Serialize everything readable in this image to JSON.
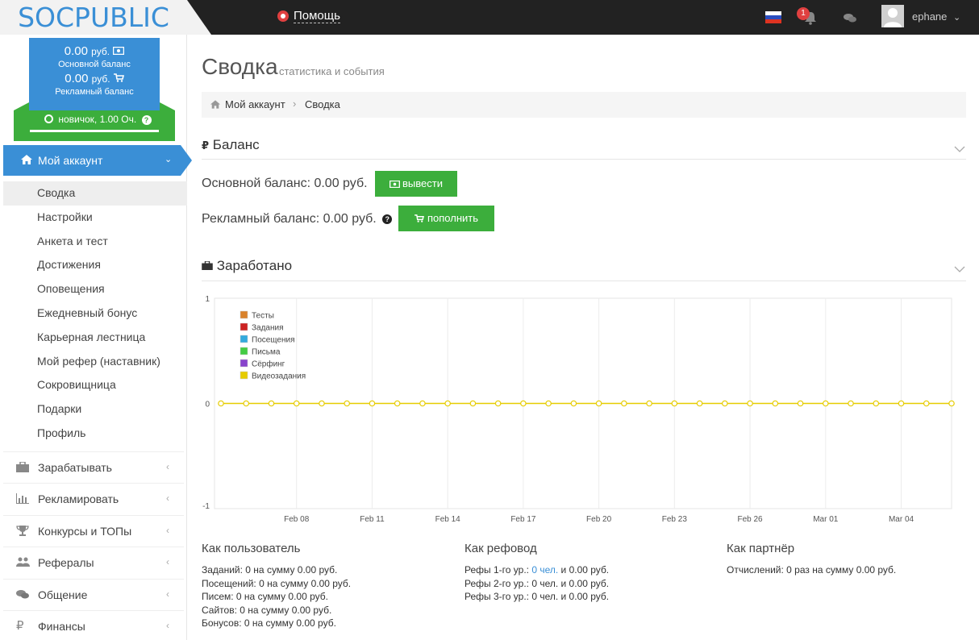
{
  "brand": {
    "logo": "SOCPUBLIC"
  },
  "topbar": {
    "help_label": "Помощь",
    "notification_count": "1",
    "username": "ephane",
    "user_chevron": "⌄"
  },
  "sidebar": {
    "main_balance": {
      "amount": "0.00",
      "currency": "руб.",
      "label": "Основной баланс"
    },
    "ad_balance": {
      "amount": "0.00",
      "currency": "руб.",
      "label": "Рекламный баланс"
    },
    "level": "новичок, 1.00 Оч.",
    "active_section": {
      "label": "Мой аккаунт",
      "chevron": "⌄"
    },
    "sub_items": [
      {
        "label": "Сводка"
      },
      {
        "label": "Настройки"
      },
      {
        "label": "Анкета и тест"
      },
      {
        "label": "Достижения"
      },
      {
        "label": "Оповещения"
      },
      {
        "label": "Ежедневный бонус"
      },
      {
        "label": "Карьерная лестница"
      },
      {
        "label": "Мой рефер (наставник)"
      },
      {
        "label": "Сокровищница"
      },
      {
        "label": "Подарки"
      },
      {
        "label": "Профиль"
      }
    ],
    "nav_items": [
      {
        "label": "Зарабатывать",
        "icon": "briefcase-icon",
        "glyph": "▬"
      },
      {
        "label": "Рекламировать",
        "icon": "bar-chart-icon",
        "glyph": "ılıl"
      },
      {
        "label": "Конкурсы и ТОПы",
        "icon": "trophy-icon",
        "glyph": "♆"
      },
      {
        "label": "Рефералы",
        "icon": "users-icon",
        "glyph": "👥"
      },
      {
        "label": "Общение",
        "icon": "chat-icon",
        "glyph": "💬"
      },
      {
        "label": "Финансы",
        "icon": "ruble-icon",
        "glyph": "₽"
      }
    ],
    "collapsed_chevron": "‹"
  },
  "page": {
    "title": "Сводка",
    "subtitle": "статистика и события",
    "breadcrumb": [
      "Мой аккаунт",
      "Сводка"
    ],
    "breadcrumb_sep": "›"
  },
  "balance_section": {
    "icon_glyph": "₽",
    "title": "Баланс",
    "main_line": "Основной баланс: 0.00 руб.",
    "withdraw_button": "вывести",
    "ad_line": "Рекламный баланс: 0.00 руб.",
    "topup_button": "пополнить"
  },
  "earned_section": {
    "title": "Заработано"
  },
  "chart_data": {
    "type": "line",
    "ylim": [
      -1,
      1
    ],
    "yticks": [
      "1",
      "0",
      "-1"
    ],
    "x_tick_labels": [
      "Feb 08",
      "Feb 11",
      "Feb 14",
      "Feb 17",
      "Feb 20",
      "Feb 23",
      "Feb 26",
      "Mar 01",
      "Mar 04"
    ],
    "series": [
      {
        "name": "Тесты",
        "color": "#d9822b"
      },
      {
        "name": "Задания",
        "color": "#cc2222"
      },
      {
        "name": "Посещения",
        "color": "#33aadd"
      },
      {
        "name": "Письма",
        "color": "#44cc44"
      },
      {
        "name": "Сёрфинг",
        "color": "#8844cc"
      },
      {
        "name": "Видеозадания",
        "color": "#e6cc00"
      }
    ],
    "x_dates": [
      "Feb 05",
      "Feb 06",
      "Feb 07",
      "Feb 08",
      "Feb 09",
      "Feb 10",
      "Feb 11",
      "Feb 12",
      "Feb 13",
      "Feb 14",
      "Feb 15",
      "Feb 16",
      "Feb 17",
      "Feb 18",
      "Feb 19",
      "Feb 20",
      "Feb 21",
      "Feb 22",
      "Feb 23",
      "Feb 24",
      "Feb 25",
      "Feb 26",
      "Feb 27",
      "Feb 28",
      "Mar 01",
      "Mar 02",
      "Mar 03",
      "Mar 04",
      "Mar 05",
      "Mar 06"
    ],
    "values": [
      0,
      0,
      0,
      0,
      0,
      0,
      0,
      0,
      0,
      0,
      0,
      0,
      0,
      0,
      0,
      0,
      0,
      0,
      0,
      0,
      0,
      0,
      0,
      0,
      0,
      0,
      0,
      0,
      0,
      0
    ],
    "legend": "top-left",
    "grid": true
  },
  "stats": {
    "user": {
      "title": "Как пользователь",
      "lines": [
        "Заданий: 0 на сумму 0.00 руб.",
        "Посещений: 0 на сумму 0.00 руб.",
        "Писем: 0 на сумму 0.00 руб.",
        "Сайтов: 0 на сумму 0.00 руб.",
        "Бонусов: 0 на сумму 0.00 руб."
      ]
    },
    "referrer": {
      "title": "Как рефовод",
      "line1_prefix": "Рефы 1-го ур.: ",
      "line1_link": "0 чел.",
      "line1_suffix": " и 0.00 руб.",
      "line2": "Рефы 2-го ур.: 0 чел. и 0.00 руб.",
      "line3": "Рефы 3-го ур.: 0 чел. и 0.00 руб."
    },
    "partner": {
      "title": "Как партнёр",
      "line": "Отчислений: 0 раз на сумму 0.00 руб."
    }
  }
}
